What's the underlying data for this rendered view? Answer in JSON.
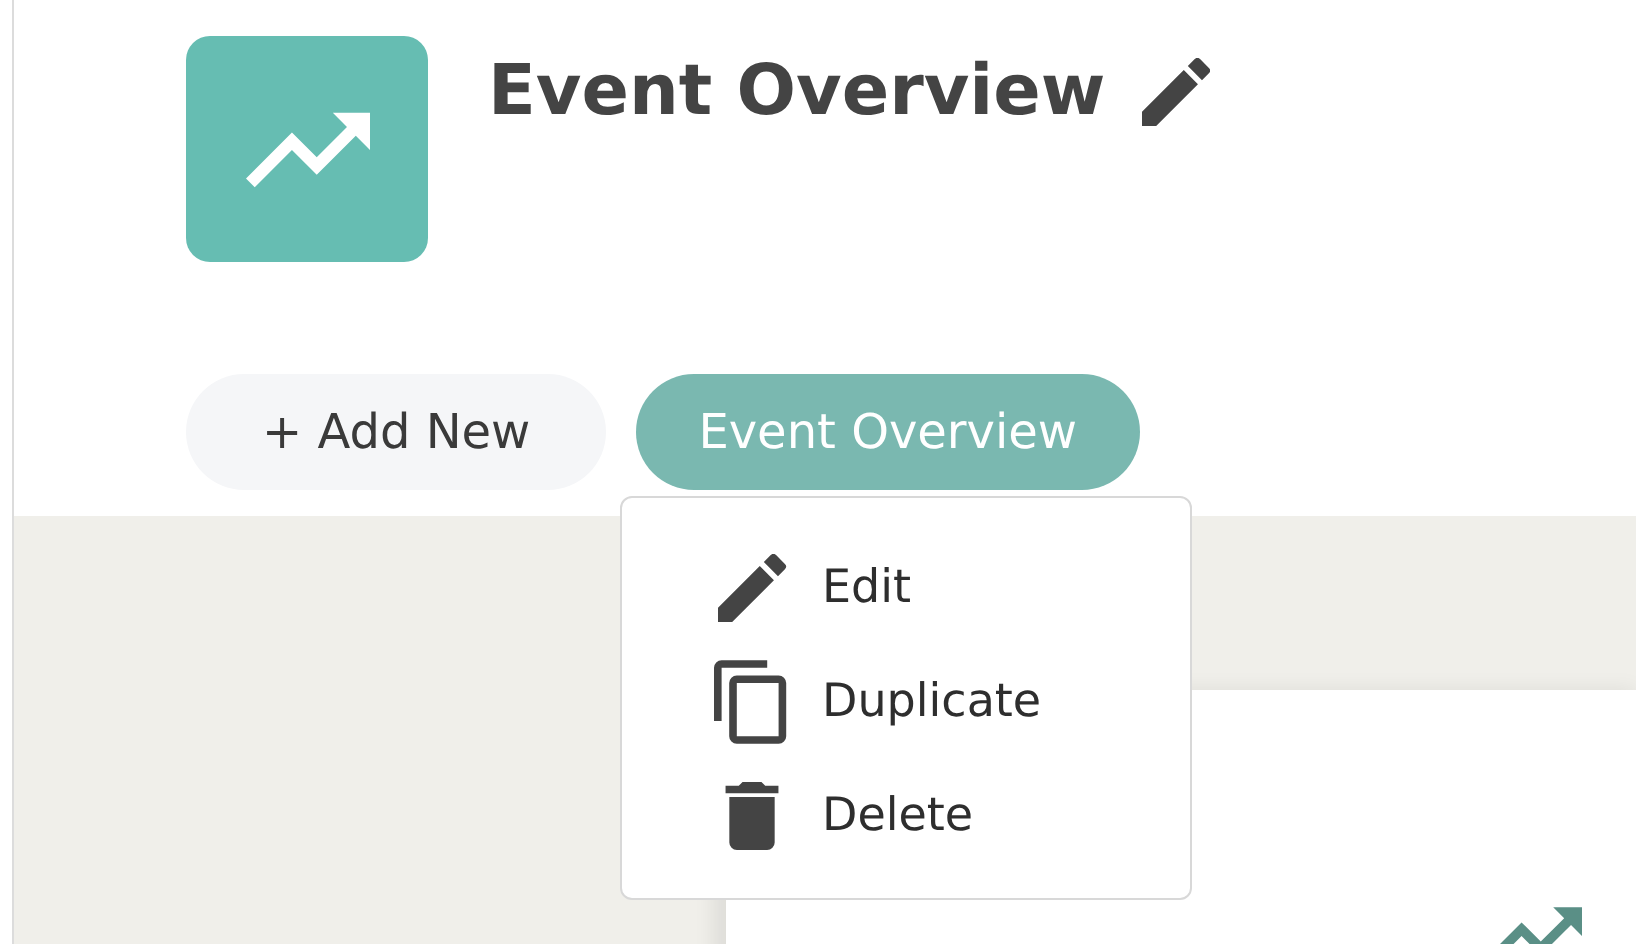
{
  "header": {
    "title": "Event Overview"
  },
  "tabs": [
    {
      "label": "+ Add New",
      "selected": false
    },
    {
      "label": "Event Overview",
      "selected": true
    }
  ],
  "menu": {
    "items": [
      {
        "label": "Edit",
        "kind": "edit"
      },
      {
        "label": "Duplicate",
        "kind": "duplicate"
      },
      {
        "label": "Delete",
        "kind": "delete"
      }
    ]
  }
}
